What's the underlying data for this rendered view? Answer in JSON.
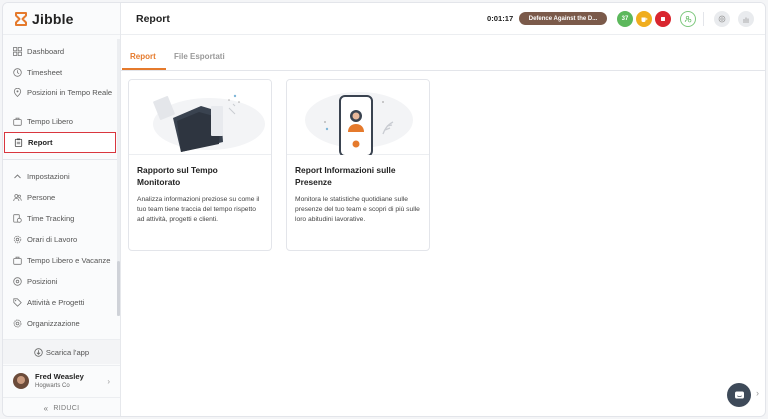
{
  "app": {
    "name": "Jibble"
  },
  "sidebar": {
    "items": [
      {
        "label": "Dashboard",
        "icon": "dashboard-icon"
      },
      {
        "label": "Timesheet",
        "icon": "clock-icon"
      },
      {
        "label": "Posizioni in Tempo Reale",
        "icon": "location-pin-icon"
      },
      {
        "label": "Tempo Libero",
        "icon": "suitcase-icon"
      },
      {
        "label": "Report",
        "icon": "clipboard-icon",
        "active": true
      }
    ],
    "settings": [
      {
        "label": "Impostazioni",
        "icon": "chevron-up-icon"
      },
      {
        "label": "Persone",
        "icon": "people-icon"
      },
      {
        "label": "Time Tracking",
        "icon": "time-tracking-icon"
      },
      {
        "label": "Orari di Lavoro",
        "icon": "gear-clock-icon"
      },
      {
        "label": "Tempo Libero e Vacanze",
        "icon": "suitcase-icon"
      },
      {
        "label": "Posizioni",
        "icon": "location-pin-icon"
      },
      {
        "label": "Attività e Progetti",
        "icon": "tag-icon"
      },
      {
        "label": "Organizzazione",
        "icon": "gear-icon"
      }
    ],
    "download_label": "Scarica l'app",
    "user": {
      "name": "Fred Weasley",
      "org": "Hogwarts Co"
    },
    "collapse_label": "RIDUCI"
  },
  "header": {
    "title": "Report",
    "timer": "0:01:17",
    "activity": "Defence Against the D...",
    "status_badge": "37"
  },
  "tabs": [
    {
      "label": "Report",
      "active": true
    },
    {
      "label": "File Esportati",
      "active": false
    }
  ],
  "cards": [
    {
      "title": "Rapporto sul Tempo Monitorato",
      "description": "Analizza informazioni preziose su come il tuo team tiene traccia del tempo rispetto ad attività, progetti e clienti."
    },
    {
      "title": "Report Informazioni sulle Presenze",
      "description": "Monitora le statistiche quotidiane sulle presenze del tuo team e scopri di più sulle loro abitudini lavorative."
    }
  ],
  "colors": {
    "accent": "#e57a2c",
    "active_outline": "#d9363e",
    "activity_pill": "#7b5a4a"
  }
}
